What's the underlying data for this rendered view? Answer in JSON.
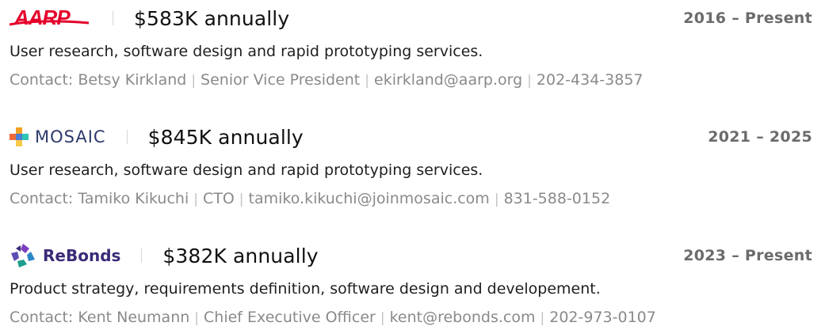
{
  "entries": [
    {
      "company": "AARP",
      "amount": "$583K annually",
      "period": "2016 – Present",
      "description": "User research, software design and rapid prototyping services.",
      "contact_label": "Contact:",
      "contact_name": "Betsy Kirkland",
      "contact_title": "Senior Vice President",
      "contact_email": "ekirkland@aarp.org",
      "contact_phone": "202-434-3857"
    },
    {
      "company": "MOSAIC",
      "amount": "$845K annually",
      "period": "2021 – 2025",
      "description": "User research, software design and rapid prototyping services.",
      "contact_label": "Contact:",
      "contact_name": "Tamiko Kikuchi",
      "contact_title": "CTO",
      "contact_email": "tamiko.kikuchi@joinmosaic.com",
      "contact_phone": "831-588-0152"
    },
    {
      "company": "ReBonds",
      "amount": "$382K annually",
      "period": "2023 – Present",
      "description": "Product strategy, requirements definition, software design and developement.",
      "contact_label": "Contact:",
      "contact_name": "Kent Neumann",
      "contact_title": "Chief Executive Officer",
      "contact_email": "kent@rebonds.com",
      "contact_phone": "202-973-0107"
    }
  ],
  "separator": "|",
  "colors": {
    "aarp_red": "#e4002b",
    "mosaic_navy": "#2f3a6b",
    "rebonds_purple": "#3b2a78",
    "period_gray": "#6b6b6b",
    "contact_gray": "#8a8a8a"
  },
  "icons": {
    "aarp": "aarp-logo-icon",
    "mosaic": "mosaic-logo-icon",
    "rebonds": "rebonds-logo-icon"
  }
}
